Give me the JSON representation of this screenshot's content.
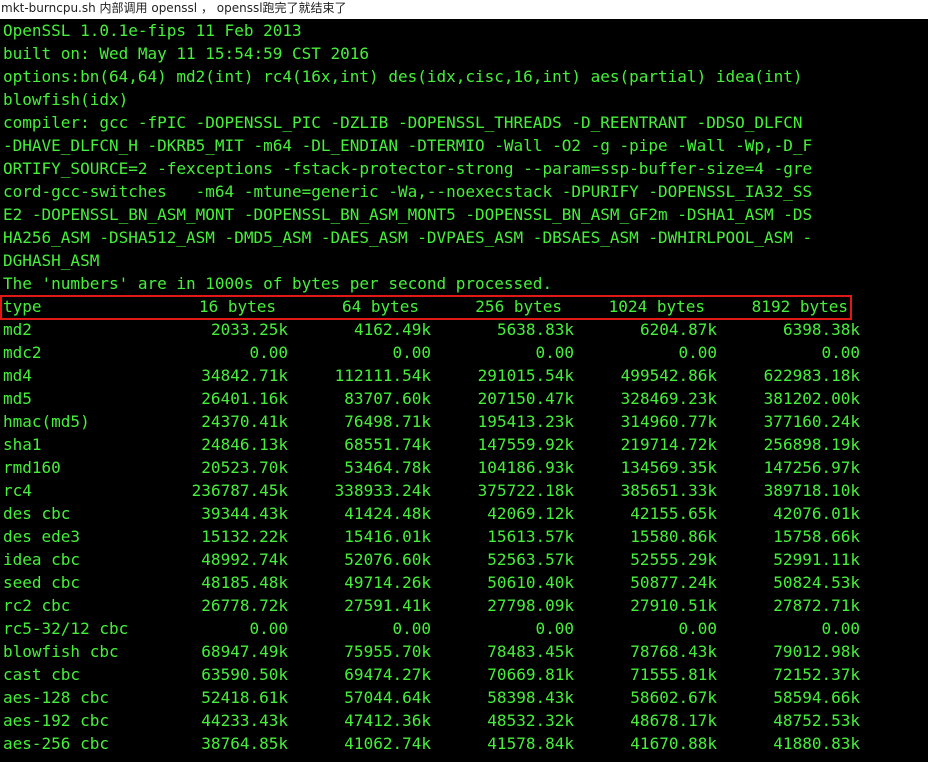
{
  "caption": "mkt-burncpu.sh 内部调用 openssl ， openssl跑完了就结束了",
  "terminal": {
    "intro": [
      "OpenSSL 1.0.1e-fips 11 Feb 2013",
      "built on: Wed May 11 15:54:59 CST 2016",
      "options:bn(64,64) md2(int) rc4(16x,int) des(idx,cisc,16,int) aes(partial) idea(int)",
      "blowfish(idx)",
      "compiler: gcc -fPIC -DOPENSSL_PIC -DZLIB -DOPENSSL_THREADS -D_REENTRANT -DDSO_DLFCN",
      "-DHAVE_DLFCN_H -DKRB5_MIT -m64 -DL_ENDIAN -DTERMIO -Wall -O2 -g -pipe -Wall -Wp,-D_F",
      "ORTIFY_SOURCE=2 -fexceptions -fstack-protector-strong --param=ssp-buffer-size=4 -gre",
      "cord-gcc-switches   -m64 -mtune=generic -Wa,--noexecstack -DPURIFY -DOPENSSL_IA32_SS",
      "E2 -DOPENSSL_BN_ASM_MONT -DOPENSSL_BN_ASM_MONT5 -DOPENSSL_BN_ASM_GF2m -DSHA1_ASM -DS",
      "HA256_ASM -DSHA512_ASM -DMD5_ASM -DAES_ASM -DVPAES_ASM -DBSAES_ASM -DWHIRLPOOL_ASM -",
      "DGHASH_ASM",
      "The 'numbers' are in 1000s of bytes per second processed."
    ],
    "header": {
      "type": "type",
      "cols": [
        "16 bytes",
        "64 bytes",
        "256 bytes",
        "1024 bytes",
        "8192 bytes"
      ]
    },
    "rows": [
      {
        "name": "md2",
        "v": [
          "2033.25k",
          "4162.49k",
          "5638.83k",
          "6204.87k",
          "6398.38k"
        ]
      },
      {
        "name": "mdc2",
        "v": [
          "0.00",
          "0.00",
          "0.00",
          "0.00",
          "0.00"
        ]
      },
      {
        "name": "md4",
        "v": [
          "34842.71k",
          "112111.54k",
          "291015.54k",
          "499542.86k",
          "622983.18k"
        ]
      },
      {
        "name": "md5",
        "v": [
          "26401.16k",
          "83707.60k",
          "207150.47k",
          "328469.23k",
          "381202.00k"
        ]
      },
      {
        "name": "hmac(md5)",
        "v": [
          "24370.41k",
          "76498.71k",
          "195413.23k",
          "314960.77k",
          "377160.24k"
        ]
      },
      {
        "name": "sha1",
        "v": [
          "24846.13k",
          "68551.74k",
          "147559.92k",
          "219714.72k",
          "256898.19k"
        ]
      },
      {
        "name": "rmd160",
        "v": [
          "20523.70k",
          "53464.78k",
          "104186.93k",
          "134569.35k",
          "147256.97k"
        ]
      },
      {
        "name": "rc4",
        "v": [
          "236787.45k",
          "338933.24k",
          "375722.18k",
          "385651.33k",
          "389718.10k"
        ]
      },
      {
        "name": "des cbc",
        "v": [
          "39344.43k",
          "41424.48k",
          "42069.12k",
          "42155.65k",
          "42076.01k"
        ]
      },
      {
        "name": "des ede3",
        "v": [
          "15132.22k",
          "15416.01k",
          "15613.57k",
          "15580.86k",
          "15758.66k"
        ]
      },
      {
        "name": "idea cbc",
        "v": [
          "48992.74k",
          "52076.60k",
          "52563.57k",
          "52555.29k",
          "52991.11k"
        ]
      },
      {
        "name": "seed cbc",
        "v": [
          "48185.48k",
          "49714.26k",
          "50610.40k",
          "50877.24k",
          "50824.53k"
        ]
      },
      {
        "name": "rc2 cbc",
        "v": [
          "26778.72k",
          "27591.41k",
          "27798.09k",
          "27910.51k",
          "27872.71k"
        ]
      },
      {
        "name": "rc5-32/12 cbc",
        "v": [
          "0.00",
          "0.00",
          "0.00",
          "0.00",
          "0.00"
        ]
      },
      {
        "name": "blowfish cbc",
        "v": [
          "68947.49k",
          "75955.70k",
          "78483.45k",
          "78768.43k",
          "79012.98k"
        ]
      },
      {
        "name": "cast cbc",
        "v": [
          "63590.50k",
          "69474.27k",
          "70669.81k",
          "71555.81k",
          "72152.37k"
        ]
      },
      {
        "name": "aes-128 cbc",
        "v": [
          "52418.61k",
          "57044.64k",
          "58398.43k",
          "58602.67k",
          "58594.66k"
        ]
      },
      {
        "name": "aes-192 cbc",
        "v": [
          "44233.43k",
          "47412.36k",
          "48532.32k",
          "48678.17k",
          "48752.53k"
        ]
      },
      {
        "name": "aes-256 cbc",
        "v": [
          "38764.85k",
          "41062.74k",
          "41578.84k",
          "41670.88k",
          "41880.83k"
        ]
      }
    ]
  },
  "colors": {
    "terminal_bg": "#000000",
    "terminal_fg": "#46f03a",
    "highlight_box": "#e01818"
  }
}
